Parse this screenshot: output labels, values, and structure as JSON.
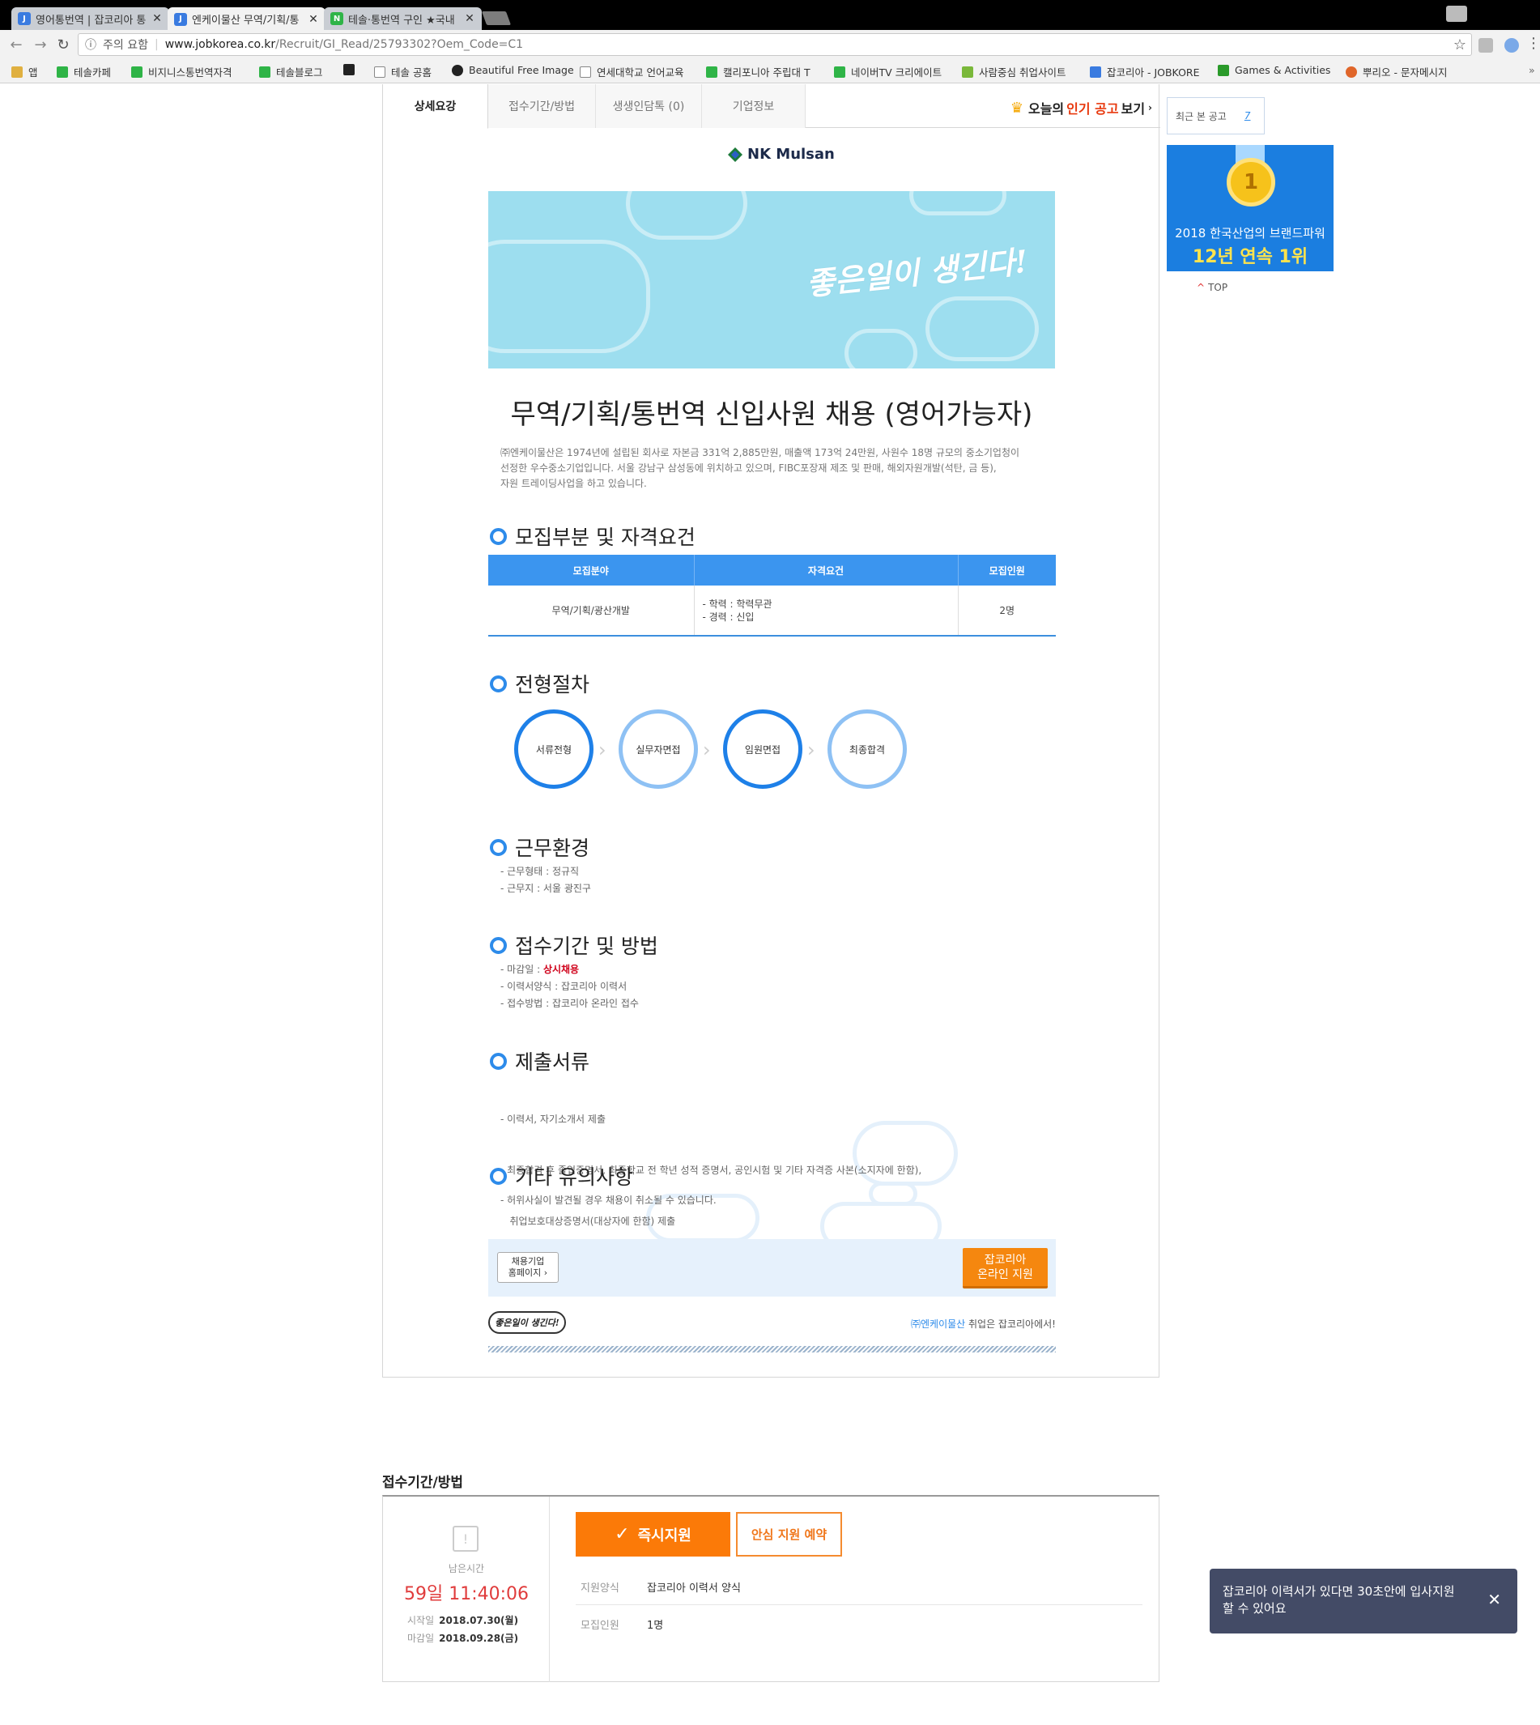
{
  "browser": {
    "tabs": [
      {
        "title": "영어통번역 | 잡코리아 통",
        "active": false,
        "fav": "#3a7be0"
      },
      {
        "title": "엔케이물산 무역/기획/통",
        "active": true,
        "fav": "#3a7be0"
      },
      {
        "title": "테솔·통번역 구인 ★국내",
        "active": false,
        "fav": "#2fb447"
      }
    ],
    "url_security": "주의 요함",
    "url_host": "www.jobkorea.co.kr",
    "url_path": "/Recruit/GI_Read/25793302?Oem_Code=C1",
    "bookmarks": [
      {
        "label": "앱",
        "color": "#e6e6e6"
      },
      {
        "label": "테솔카페",
        "color": "#2fb447"
      },
      {
        "label": "비지니스통번역자격",
        "color": "#2fb447"
      },
      {
        "label": "테솔블로그",
        "color": "#2fb447"
      },
      {
        "label": "",
        "color": "#222"
      },
      {
        "label": "테솔 공홈",
        "color": "#fff"
      },
      {
        "label": "Beautiful Free Image",
        "color": "#222"
      },
      {
        "label": "연세대학교 언어교육",
        "color": "#fff"
      },
      {
        "label": "캘리포니아 주립대 T",
        "color": "#2fb447"
      },
      {
        "label": "네이버TV 크리에이트",
        "color": "#2fb447"
      },
      {
        "label": "사람중심 취업사이트",
        "color": "#7ab83a"
      },
      {
        "label": "잡코리아 - JOBKORE",
        "color": "#3a7be0"
      },
      {
        "label": "Games & Activities",
        "color": "#2a9a2a"
      },
      {
        "label": "뿌리오 - 문자메시지",
        "color": "#e0662a"
      }
    ]
  },
  "detail_tabs": [
    "상세요강",
    "접수기간/방법",
    "생생인담톡 (0)",
    "기업정보"
  ],
  "hot_link": {
    "prefix": "오늘의",
    "highlight": "인기 공고",
    "suffix": "보기"
  },
  "company_logo": "NK Mulsan",
  "banner_slogan": "좋은일이 생긴다!",
  "job_title": "무역/기획/통번역 신입사원 채용 (영어가능자)",
  "intro_lines": [
    "㈜엔케이물산은 1974년에 설립된 회사로 자본금 331억 2,885만원, 매출액 173억 24만원, 사원수 18명 규모의 중소기업청이",
    "선정한 우수중소기업입니다. 서울 강남구 삼성동에 위치하고 있으며, FIBC포장재 제조 및 판매, 해외자원개발(석탄, 금 등),",
    "자원 트레이딩사업을 하고 있습니다."
  ],
  "sections": {
    "recruit": "모집부분 및 자격요건",
    "process": "전형절차",
    "environment": "근무환경",
    "period": "접수기간 및 방법",
    "documents": "제출서류",
    "etc": "기타 유의사항"
  },
  "recruit_table": {
    "headers": [
      "모집분야",
      "자격요건",
      "모집인원"
    ],
    "field": "무역/기획/광산개발",
    "qualifications": [
      "- 학력 : 학력무관",
      "- 경력 : 신입"
    ],
    "count": "2명"
  },
  "process_steps": [
    "서류전형",
    "실무자면접",
    "임원면접",
    "최종합격"
  ],
  "environment_items": [
    "- 근무형태 : 정규직",
    "- 근무지 : 서울 광진구"
  ],
  "period_items": {
    "deadline_label": "- 마감일 : ",
    "deadline_value": "상시채용",
    "resume": "- 이력서양식 : 잡코리아 이력서",
    "method": "- 접수방법 : 잡코리아 온라인 접수"
  },
  "document_items": [
    "- 이력서, 자기소개서 제출",
    "- 최종합격 후 졸업증명서, 최종학교 전 학년 성적 증명서, 공인시험 및 기타 자격증 사본(소지자에 한함),",
    "   취업보호대상증명서(대상자에 한함) 제출"
  ],
  "etc_items": [
    "- 허위사실이 발견될 경우 채용이 취소될 수 있습니다."
  ],
  "apply_bar": {
    "homepage_btn_1": "채용기업",
    "homepage_btn_2": "홈페이지 ›",
    "online_btn_1": "잡코리아",
    "online_btn_2": "온라인 지원"
  },
  "footer": {
    "badge": "좋은일이 생긴다!",
    "company": "㈜엔케이물산",
    "text": " 취업은 잡코리아에서!"
  },
  "sidebar": {
    "recent_label": "최근 본 공고",
    "recent_count": "7",
    "ad_line1": "2018 한국산업의 브랜드파워",
    "ad_line2": "12년 연속 1위",
    "ad_medal": "1",
    "top_label": "TOP"
  },
  "application": {
    "title": "접수기간/방법",
    "remain_label": "남은시간",
    "remain_time": "59일 11:40:06",
    "start_label": "시작일",
    "start_date": "2018.07.30(월)",
    "end_label": "마감일",
    "end_date": "2018.09.28(금)",
    "apply_now": "즉시지원",
    "reserve": "안심 지원 예약",
    "form_label": "지원양식",
    "form_value": "잡코리아 이력서 양식",
    "count_label": "모집인원",
    "count_value": "1명"
  },
  "toast": {
    "message": "잡코리아 이력서가 있다면 30초안에 입사지원 할 수 있어요"
  }
}
